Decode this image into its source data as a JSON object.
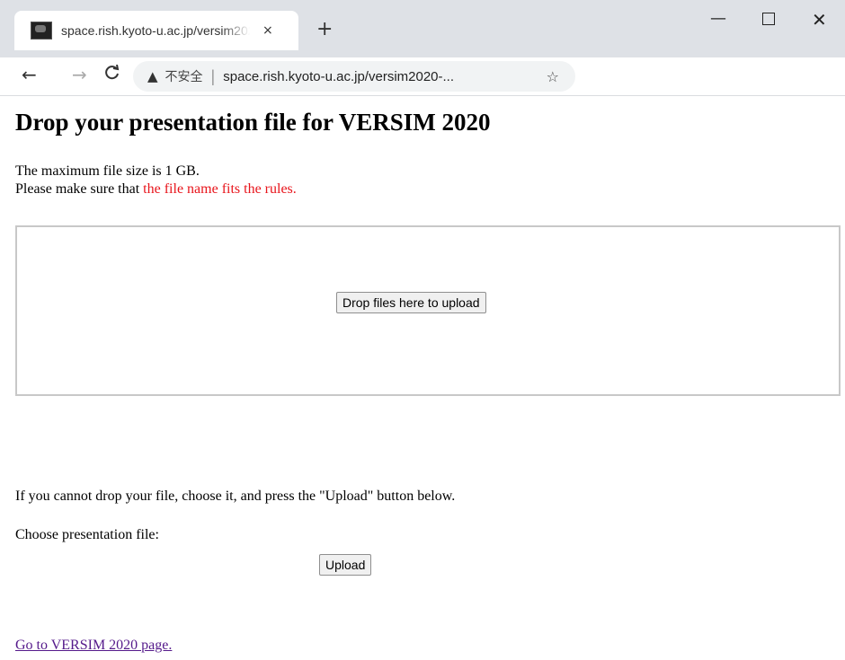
{
  "browser": {
    "tab_title": "space.rish.kyoto-u.ac.jp/versim2020",
    "tab_close": "×",
    "new_tab": "+",
    "window_controls": {
      "minimize": "—",
      "close": "✕"
    },
    "nav": {
      "back": "←",
      "forward": "→",
      "reload": "C"
    },
    "address": {
      "warning_icon": "warning-triangle-icon",
      "security_label": "不安全",
      "separator": "|",
      "url": "space.rish.kyoto-u.ac.jp/versim2020-...",
      "bookmark_icon": "star-icon"
    }
  },
  "page": {
    "title": "Drop your presentation file for VERSIM 2020",
    "max_size": "The maximum file size is 1 GB.",
    "rules_prefix": "Please make sure that ",
    "rules_link": "the file name fits the rules.",
    "drop_button": "Drop files here to upload",
    "fallback_text": "If you cannot drop your file, choose it, and press the \"Upload\" button below.",
    "choose_label": "Choose presentation file:",
    "upload_button": "Upload",
    "back_link": "Go to VERSIM 2020 page."
  },
  "colors": {
    "link_red": "#e8141b",
    "visited_link": "#551a8b"
  }
}
